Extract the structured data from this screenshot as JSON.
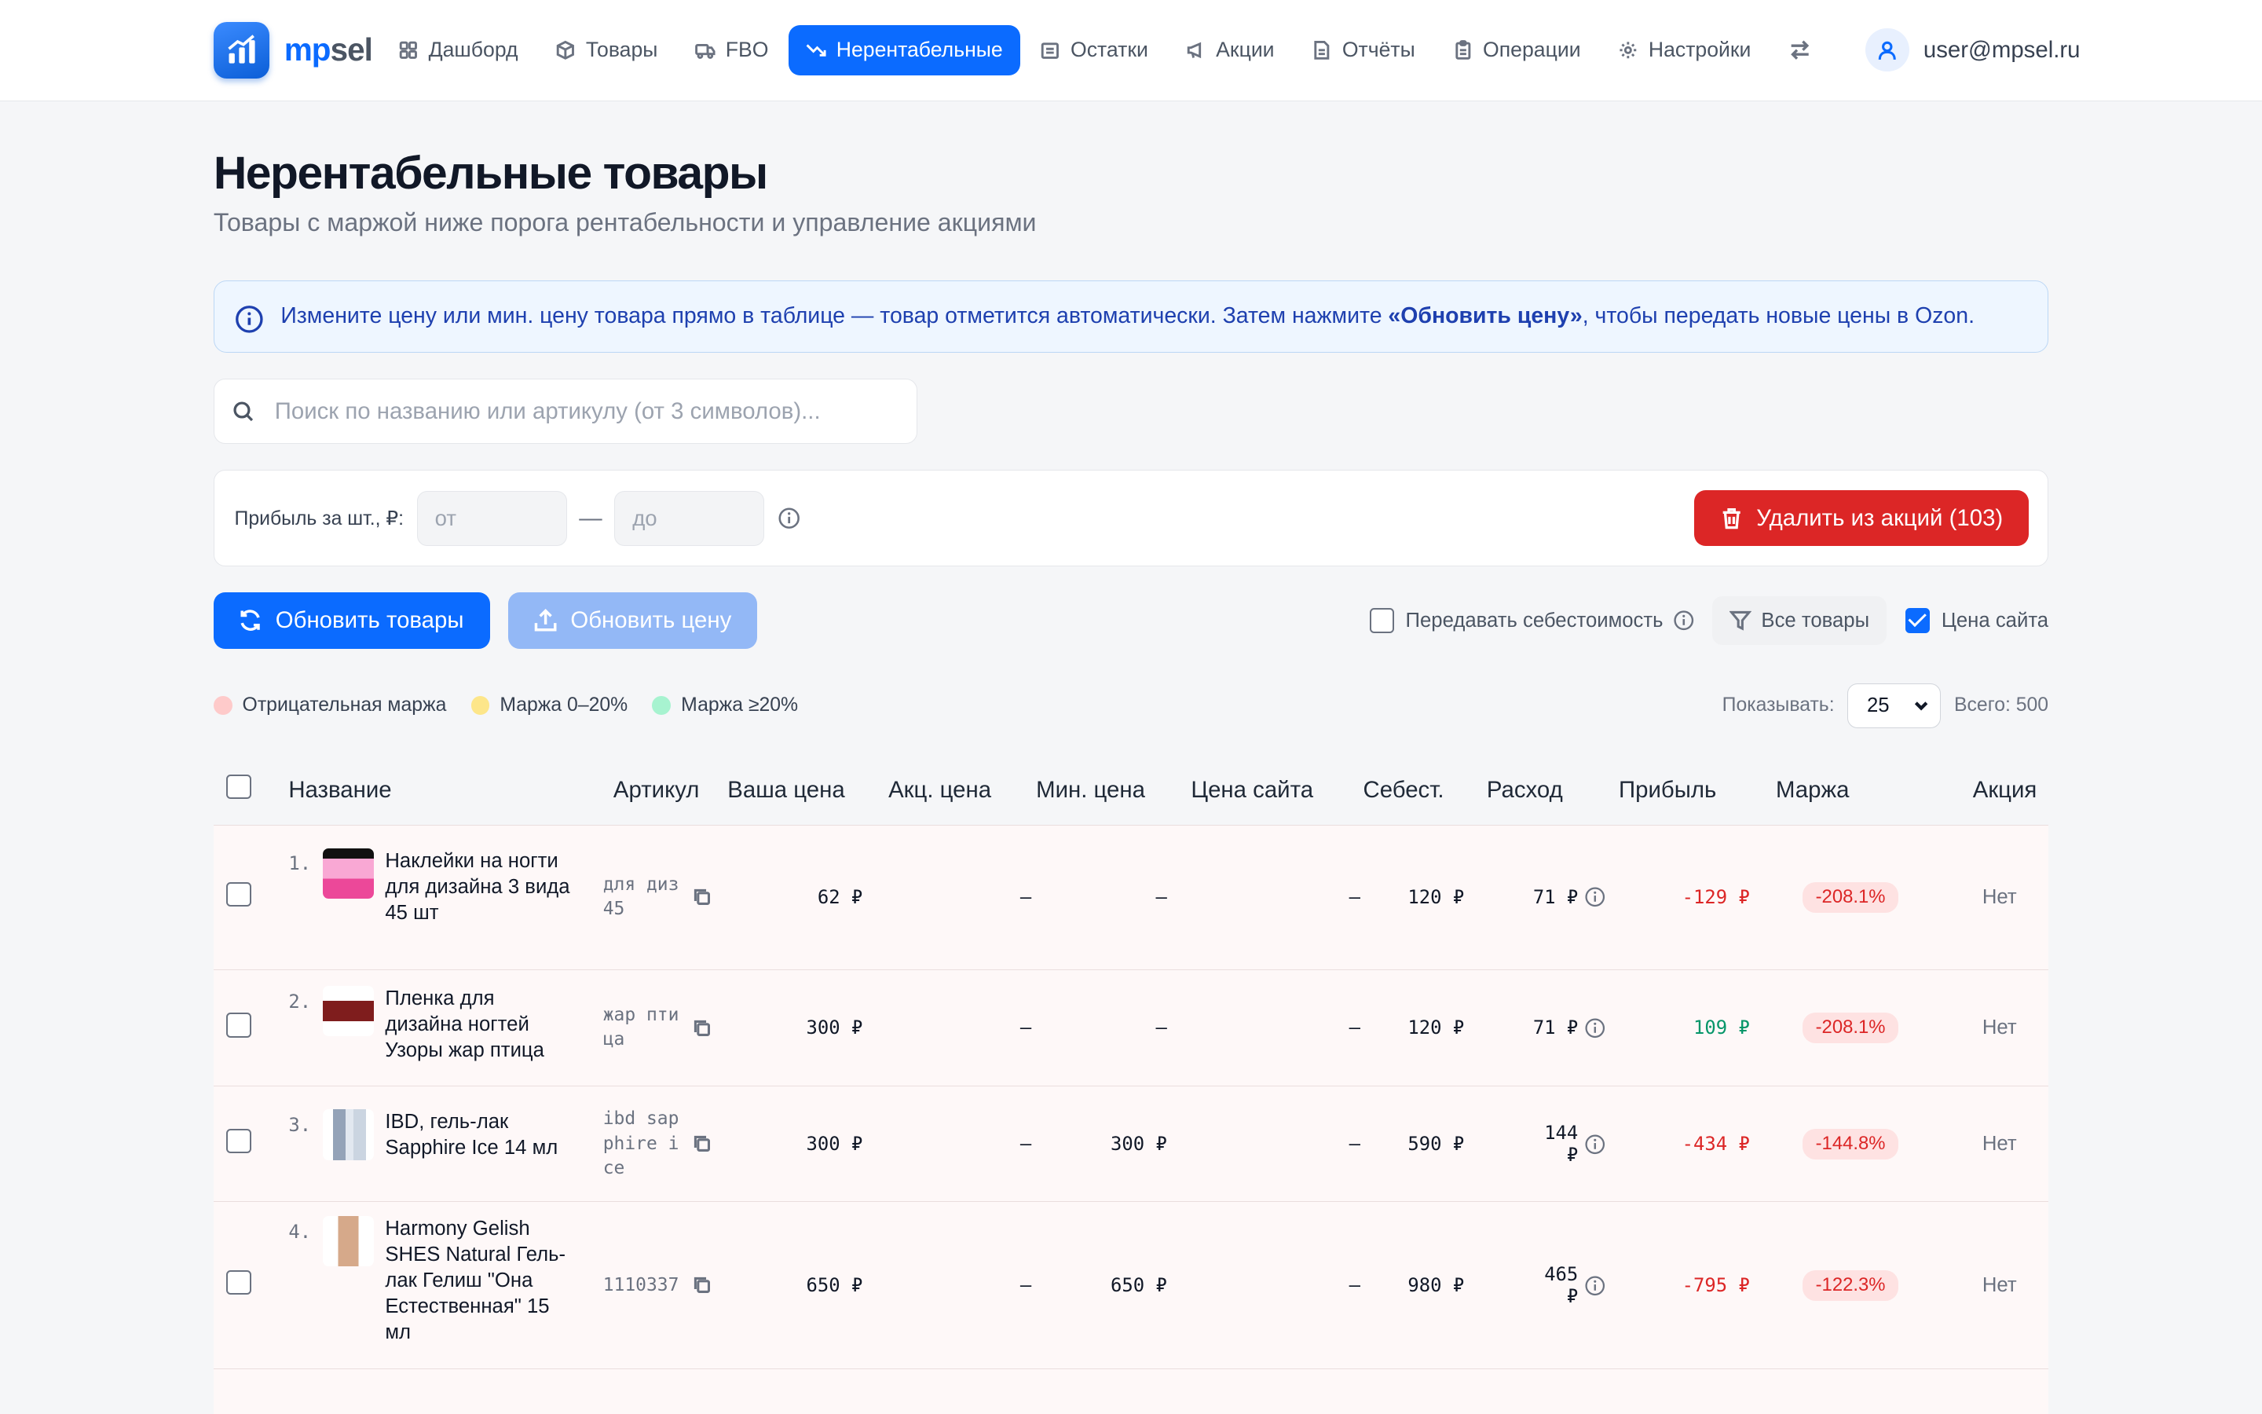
{
  "app": {
    "logo_a": "mp",
    "logo_b": "sel",
    "user": "user@mpsel.ru"
  },
  "nav": [
    {
      "label": "Дашборд",
      "icon": "grid-icon"
    },
    {
      "label": "Товары",
      "icon": "box-icon"
    },
    {
      "label": "FBO",
      "icon": "truck-icon"
    },
    {
      "label": "Нерентабельные",
      "icon": "trending-down-icon",
      "active": true
    },
    {
      "label": "Остатки",
      "icon": "warehouse-icon"
    },
    {
      "label": "Акции",
      "icon": "megaphone-icon"
    },
    {
      "label": "Отчёты",
      "icon": "file-icon"
    },
    {
      "label": "Операции",
      "icon": "clipboard-icon"
    },
    {
      "label": "Настройки",
      "icon": "gear-icon"
    }
  ],
  "page": {
    "title": "Нерентабельные товары",
    "subtitle": "Товары с маржой ниже порога рентабельности и управление акциями"
  },
  "info": {
    "text_before": "Измените цену или мин. цену товара прямо в таблице — товар отметится автоматически. Затем нажмите ",
    "bold": "«Обновить цену»",
    "text_after": ", чтобы передать новые цены в Ozon."
  },
  "search": {
    "placeholder": "Поиск по названию или артикулу (от 3 символов)..."
  },
  "filters": {
    "label": "Прибыль за шт., ₽:",
    "from_placeholder": "от",
    "dash": "—",
    "to_placeholder": "до",
    "delete_button": "Удалить из акций (103)"
  },
  "actions": {
    "refresh_goods": "Обновить товары",
    "update_price": "Обновить цену",
    "transfer_cost": "Передавать себестоимость",
    "all_goods": "Все товары",
    "site_price": "Цена сайта",
    "site_price_checked": true
  },
  "legend": [
    {
      "label": "Отрицательная маржа",
      "color": "#fecaca"
    },
    {
      "label": "Маржа 0–20%",
      "color": "#fde68a"
    },
    {
      "label": "Маржа ≥20%",
      "color": "#a7f3d0"
    }
  ],
  "paging": {
    "show_label": "Показывать:",
    "per_page": "25",
    "total": "Всего: 500"
  },
  "table": {
    "headers": {
      "name": "Название",
      "article": "Артикул",
      "price": "Ваша цена",
      "promo_price": "Акц. цена",
      "min_price": "Мин. цена",
      "site_price": "Цена сайта",
      "cost": "Себест.",
      "expense": "Расход",
      "profit": "Прибыль",
      "margin": "Маржа",
      "promo": "Акция"
    },
    "rows": [
      {
        "n": "1.",
        "name": "Наклейки на ногти для дизайна 3 вида 45 шт",
        "article": "для диз 45",
        "price": "62 ₽",
        "promo_price": "—",
        "min_price": "—",
        "site_price": "—",
        "cost": "120 ₽",
        "expense": "71 ₽",
        "profit": "-129 ₽",
        "profit_sign": "neg",
        "margin": "-208.1%",
        "promo": "Нет",
        "thumb": "#f472b6"
      },
      {
        "n": "2.",
        "name": "Пленка для дизайна ногтей Узоры жар птица",
        "article": "жар птица",
        "price": "300 ₽",
        "promo_price": "—",
        "min_price": "—",
        "site_price": "—",
        "cost": "120 ₽",
        "expense": "71 ₽",
        "profit": "109 ₽",
        "profit_sign": "pos",
        "margin": "-208.1%",
        "promo": "Нет",
        "thumb": "#7f1d1d"
      },
      {
        "n": "3.",
        "name": "IBD, гель-лак Sapphire Ice 14 мл",
        "article": "ibd sapphire ice",
        "price": "300 ₽",
        "promo_price": "—",
        "min_price": "300 ₽",
        "site_price": "—",
        "cost": "590 ₽",
        "expense": "144 ₽",
        "profit": "-434 ₽",
        "profit_sign": "neg",
        "margin": "-144.8%",
        "promo": "Нет",
        "thumb": "#cbd5e1"
      },
      {
        "n": "4.",
        "name": "Harmony Gelish SHES Natural Гель-лак Гелиш \"Она Естественная\" 15 мл",
        "article": "1110337",
        "price": "650 ₽",
        "promo_price": "—",
        "min_price": "650 ₽",
        "site_price": "—",
        "cost": "980 ₽",
        "expense": "465 ₽",
        "profit": "-795 ₽",
        "profit_sign": "neg",
        "margin": "-122.3%",
        "promo": "Нет",
        "thumb": "#d6a98a"
      }
    ]
  }
}
